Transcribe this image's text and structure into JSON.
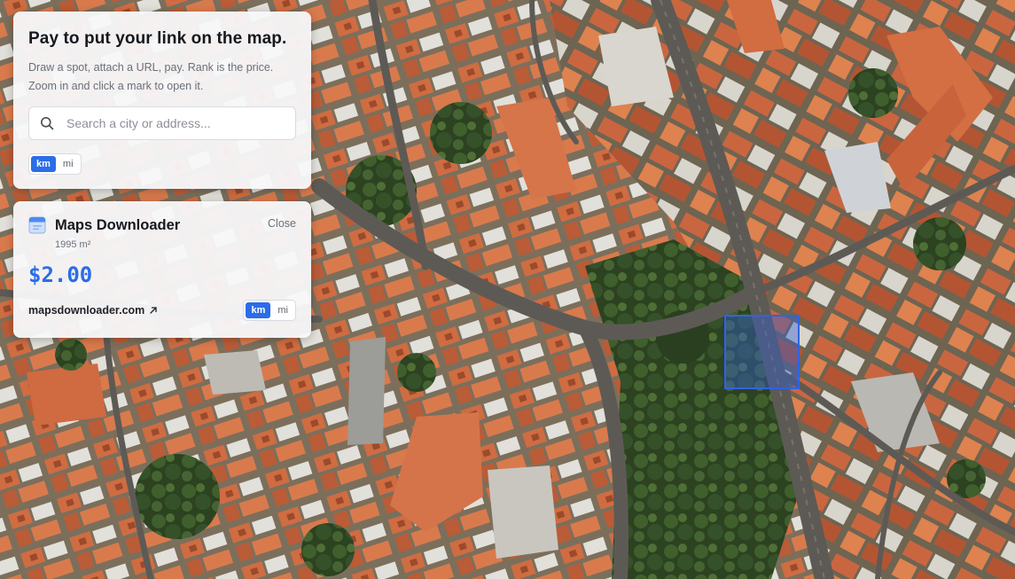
{
  "intro": {
    "title": "Pay to put your link on the map.",
    "desc_line1": "Draw a spot, attach a URL, pay. Rank is the price.",
    "desc_line2": "Zoom in and click a mark to open it."
  },
  "search": {
    "placeholder": "Search a city or address...",
    "value": "",
    "icon": "search-icon"
  },
  "units": {
    "options": [
      "km",
      "mi"
    ],
    "selected": "km"
  },
  "listing": {
    "app_icon": "browser-window-icon",
    "name": "Maps Downloader",
    "area": "1995 m²",
    "price": "$2.00",
    "link": "mapsdownloader.com",
    "link_icon": "external-arrow-icon",
    "close_label": "Close"
  },
  "map": {
    "style": "satellite",
    "selected_plot_color": "#2f63e6"
  },
  "colors": {
    "accent": "#2b6ce8",
    "roof": "#c9683f",
    "tree": "#2f4a22"
  }
}
